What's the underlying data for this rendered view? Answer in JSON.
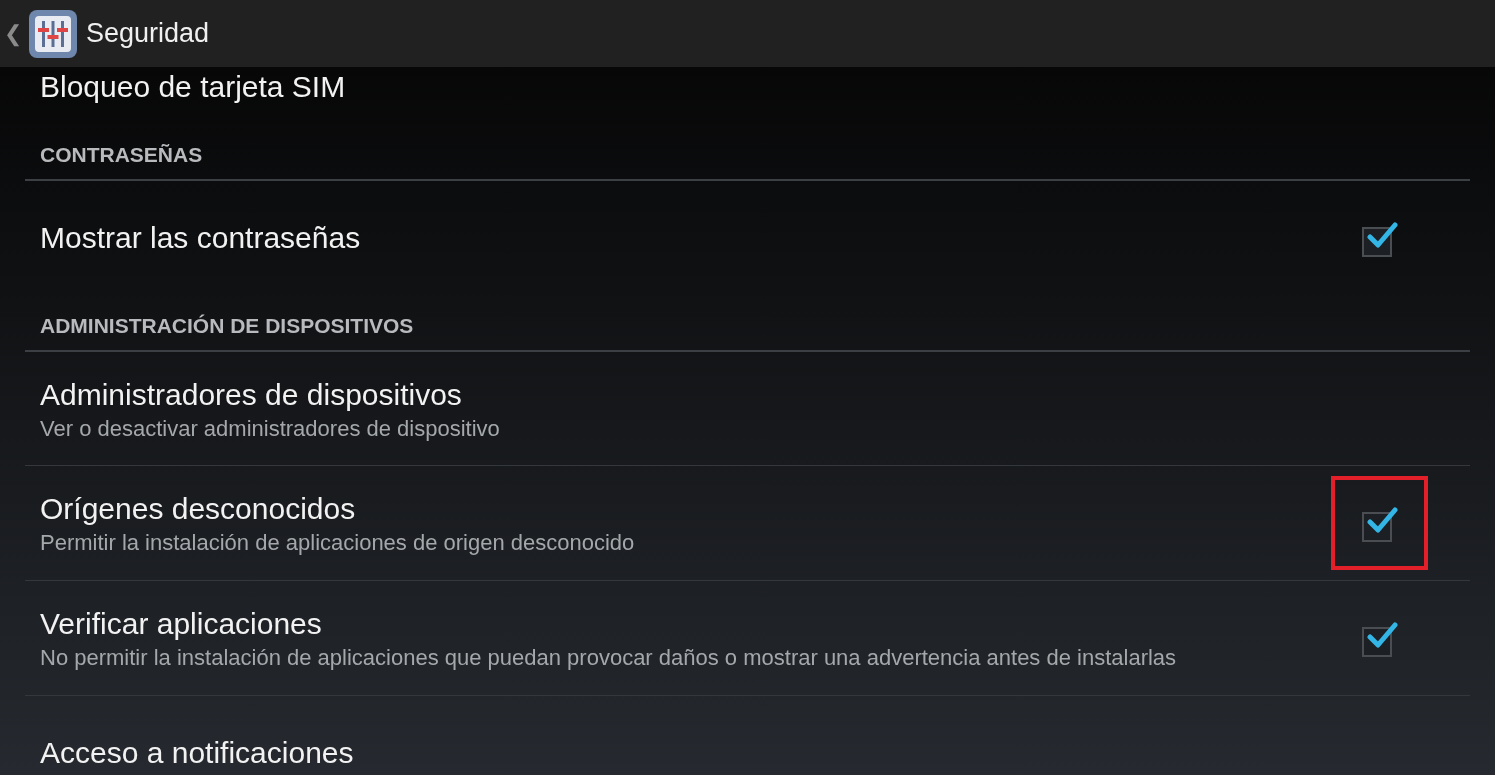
{
  "action_bar": {
    "back": "❮",
    "title": "Seguridad"
  },
  "items": [
    {
      "kind": "setting",
      "title": "Bloqueo de tarjeta SIM"
    },
    {
      "kind": "header",
      "title": "CONTRASEÑAS"
    },
    {
      "kind": "setting",
      "title": "Mostrar las contraseñas",
      "checked": true
    },
    {
      "kind": "header",
      "title": "ADMINISTRACIÓN DE DISPOSITIVOS"
    },
    {
      "kind": "setting",
      "title": "Administradores de dispositivos",
      "summary": "Ver o desactivar administradores de dispositivo"
    },
    {
      "kind": "setting",
      "title": "Orígenes desconocidos",
      "summary": "Permitir la instalación de aplicaciones de origen desconocido",
      "checked": true,
      "highlighted": true
    },
    {
      "kind": "setting",
      "title": "Verificar aplicaciones",
      "summary": "No permitir la instalación de aplicaciones que puedan provocar daños o mostrar una advertencia antes de instalarlas",
      "checked": true
    },
    {
      "kind": "setting",
      "title": "Acceso a notificaciones"
    }
  ]
}
